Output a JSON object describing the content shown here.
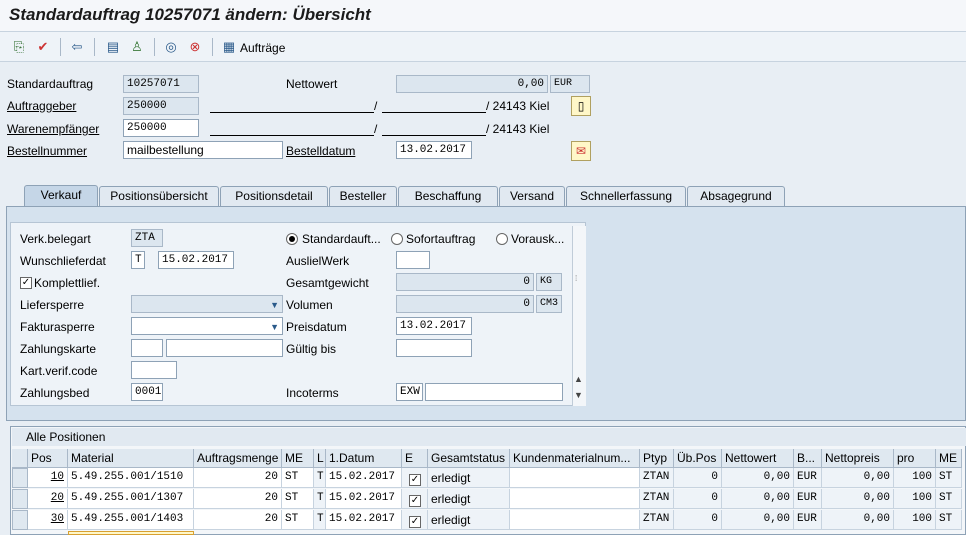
{
  "window": {
    "title": "Standardauftrag 10257071 ändern: Übersicht"
  },
  "toolbar": {
    "orders_label": "Aufträge"
  },
  "header": {
    "order_label": "Standardauftrag",
    "order_value": "10257071",
    "net_label": "Nettowert",
    "net_value": "0,00",
    "net_currency": "EUR",
    "soldto_label": "Auftraggeber",
    "soldto_value": "250000",
    "soldto_sep": "/",
    "soldto_addr": "/ 24143 Kiel",
    "shipto_label": "Warenempfänger",
    "shipto_value": "250000",
    "shipto_sep": "/",
    "shipto_addr": "/ 24143 Kiel",
    "po_label": "Bestellnummer",
    "po_value": "mailbestellung",
    "podate_label": "Bestelldatum",
    "podate_value": "13.02.2017"
  },
  "tabs": [
    {
      "label": "Verkauf"
    },
    {
      "label": "Positionsübersicht"
    },
    {
      "label": "Positionsdetail"
    },
    {
      "label": "Besteller"
    },
    {
      "label": "Beschaffung"
    },
    {
      "label": "Versand"
    },
    {
      "label": "Schnellerfassung"
    },
    {
      "label": "Absagegrund"
    }
  ],
  "sales": {
    "doctype_label": "Verk.belegart",
    "doctype_value": "ZTA",
    "reqdate_label": "Wunschlieferdat",
    "reqdate_t": "T",
    "reqdate_value": "15.02.2017",
    "complete_label": "Komplettlief.",
    "block_label": "Liefersperre",
    "billblock_label": "Fakturasperre",
    "card_label": "Zahlungskarte",
    "cardver_label": "Kart.verif.code",
    "terms_label": "Zahlungsbed",
    "terms_value": "0001",
    "radio1": "Standardauft...",
    "radio2": "Sofortauftrag",
    "radio3": "Vorausk...",
    "plant_label": "AuslielWerk",
    "weight_label": "Gesamtgewicht",
    "weight_value": "0",
    "weight_unit": "KG",
    "volume_label": "Volumen",
    "volume_value": "0",
    "volume_unit": "CM3",
    "pricedate_label": "Preisdatum",
    "pricedate_value": "13.02.2017",
    "validto_label": "Gültig bis",
    "incoterms_label": "Incoterms",
    "incoterms_value": "EXW"
  },
  "positions": {
    "title": "Alle Positionen",
    "columns": [
      "Pos",
      "Material",
      "Auftragsmenge",
      "ME",
      "L",
      "1.Datum",
      "E",
      "Gesamtstatus",
      "Kundenmaterialnum...",
      "Ptyp",
      "Üb.Pos",
      "Nettowert",
      "B...",
      "Nettopreis",
      "pro",
      "ME"
    ],
    "rows": [
      {
        "pos": "10",
        "material": "5.49.255.001/1510",
        "qty": "20",
        "me": "ST",
        "l": "T",
        "date": "15.02.2017",
        "status": "erledigt",
        "ptyp": "ZTAN",
        "ubpos": "0",
        "netval": "0,00",
        "cur": "EUR",
        "netprice": "0,00",
        "per": "100",
        "me2": "ST"
      },
      {
        "pos": "20",
        "material": "5.49.255.001/1307",
        "qty": "20",
        "me": "ST",
        "l": "T",
        "date": "15.02.2017",
        "status": "erledigt",
        "ptyp": "ZTAN",
        "ubpos": "0",
        "netval": "0,00",
        "cur": "EUR",
        "netprice": "0,00",
        "per": "100",
        "me2": "ST"
      },
      {
        "pos": "30",
        "material": "5.49.255.001/1403",
        "qty": "20",
        "me": "ST",
        "l": "T",
        "date": "15.02.2017",
        "status": "erledigt",
        "ptyp": "ZTAN",
        "ubpos": "0",
        "netval": "0,00",
        "cur": "EUR",
        "netprice": "0,00",
        "per": "100",
        "me2": "ST"
      }
    ]
  }
}
